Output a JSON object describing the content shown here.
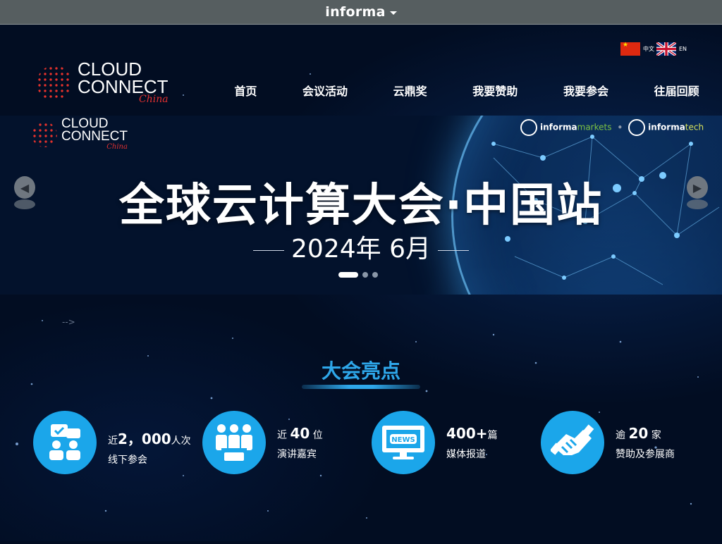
{
  "topbar": {
    "brand": "informa"
  },
  "lang": {
    "zh_label": "中文",
    "en_label": "EN"
  },
  "logo": {
    "line1": "CLOUD",
    "line2": "CONNECT",
    "script": "China"
  },
  "nav": {
    "items": [
      "首页",
      "会议活动",
      "云鼎奖",
      "我要赞助",
      "我要参会",
      "往届回顾"
    ]
  },
  "banner": {
    "logo_line1": "CLOUD",
    "logo_line2": "CONNECT",
    "logo_script": "China",
    "partner1_a": "informa",
    "partner1_b": "markets",
    "partner2_a": "informa",
    "partner2_b": "tech",
    "headline": "全球云计算大会·中国站",
    "date": "2024年 6月",
    "slide_count": 3,
    "active_slide": 1
  },
  "stray_text": "-->",
  "highlights": {
    "title": "大会亮点",
    "stats": [
      {
        "prefix": "近",
        "number": "2，000",
        "unit": "人次",
        "label": "线下参会",
        "icon": "chat-people-icon"
      },
      {
        "prefix": "近 ",
        "number": "40",
        "unit": " 位",
        "label": "演讲嘉宾",
        "icon": "speakers-icon"
      },
      {
        "prefix": "",
        "number": "400+",
        "unit": "篇",
        "label": "媒体报道",
        "icon": "news-monitor-icon"
      },
      {
        "prefix": "逾 ",
        "number": "20",
        "unit": " 家",
        "label": "赞助及参展商",
        "icon": "handshake-icon"
      }
    ]
  },
  "colors": {
    "accent": "#2ea7ea",
    "icon_bg": "#1ba6ea",
    "logo_red": "#e8322c",
    "page_bg": "#020d22"
  }
}
